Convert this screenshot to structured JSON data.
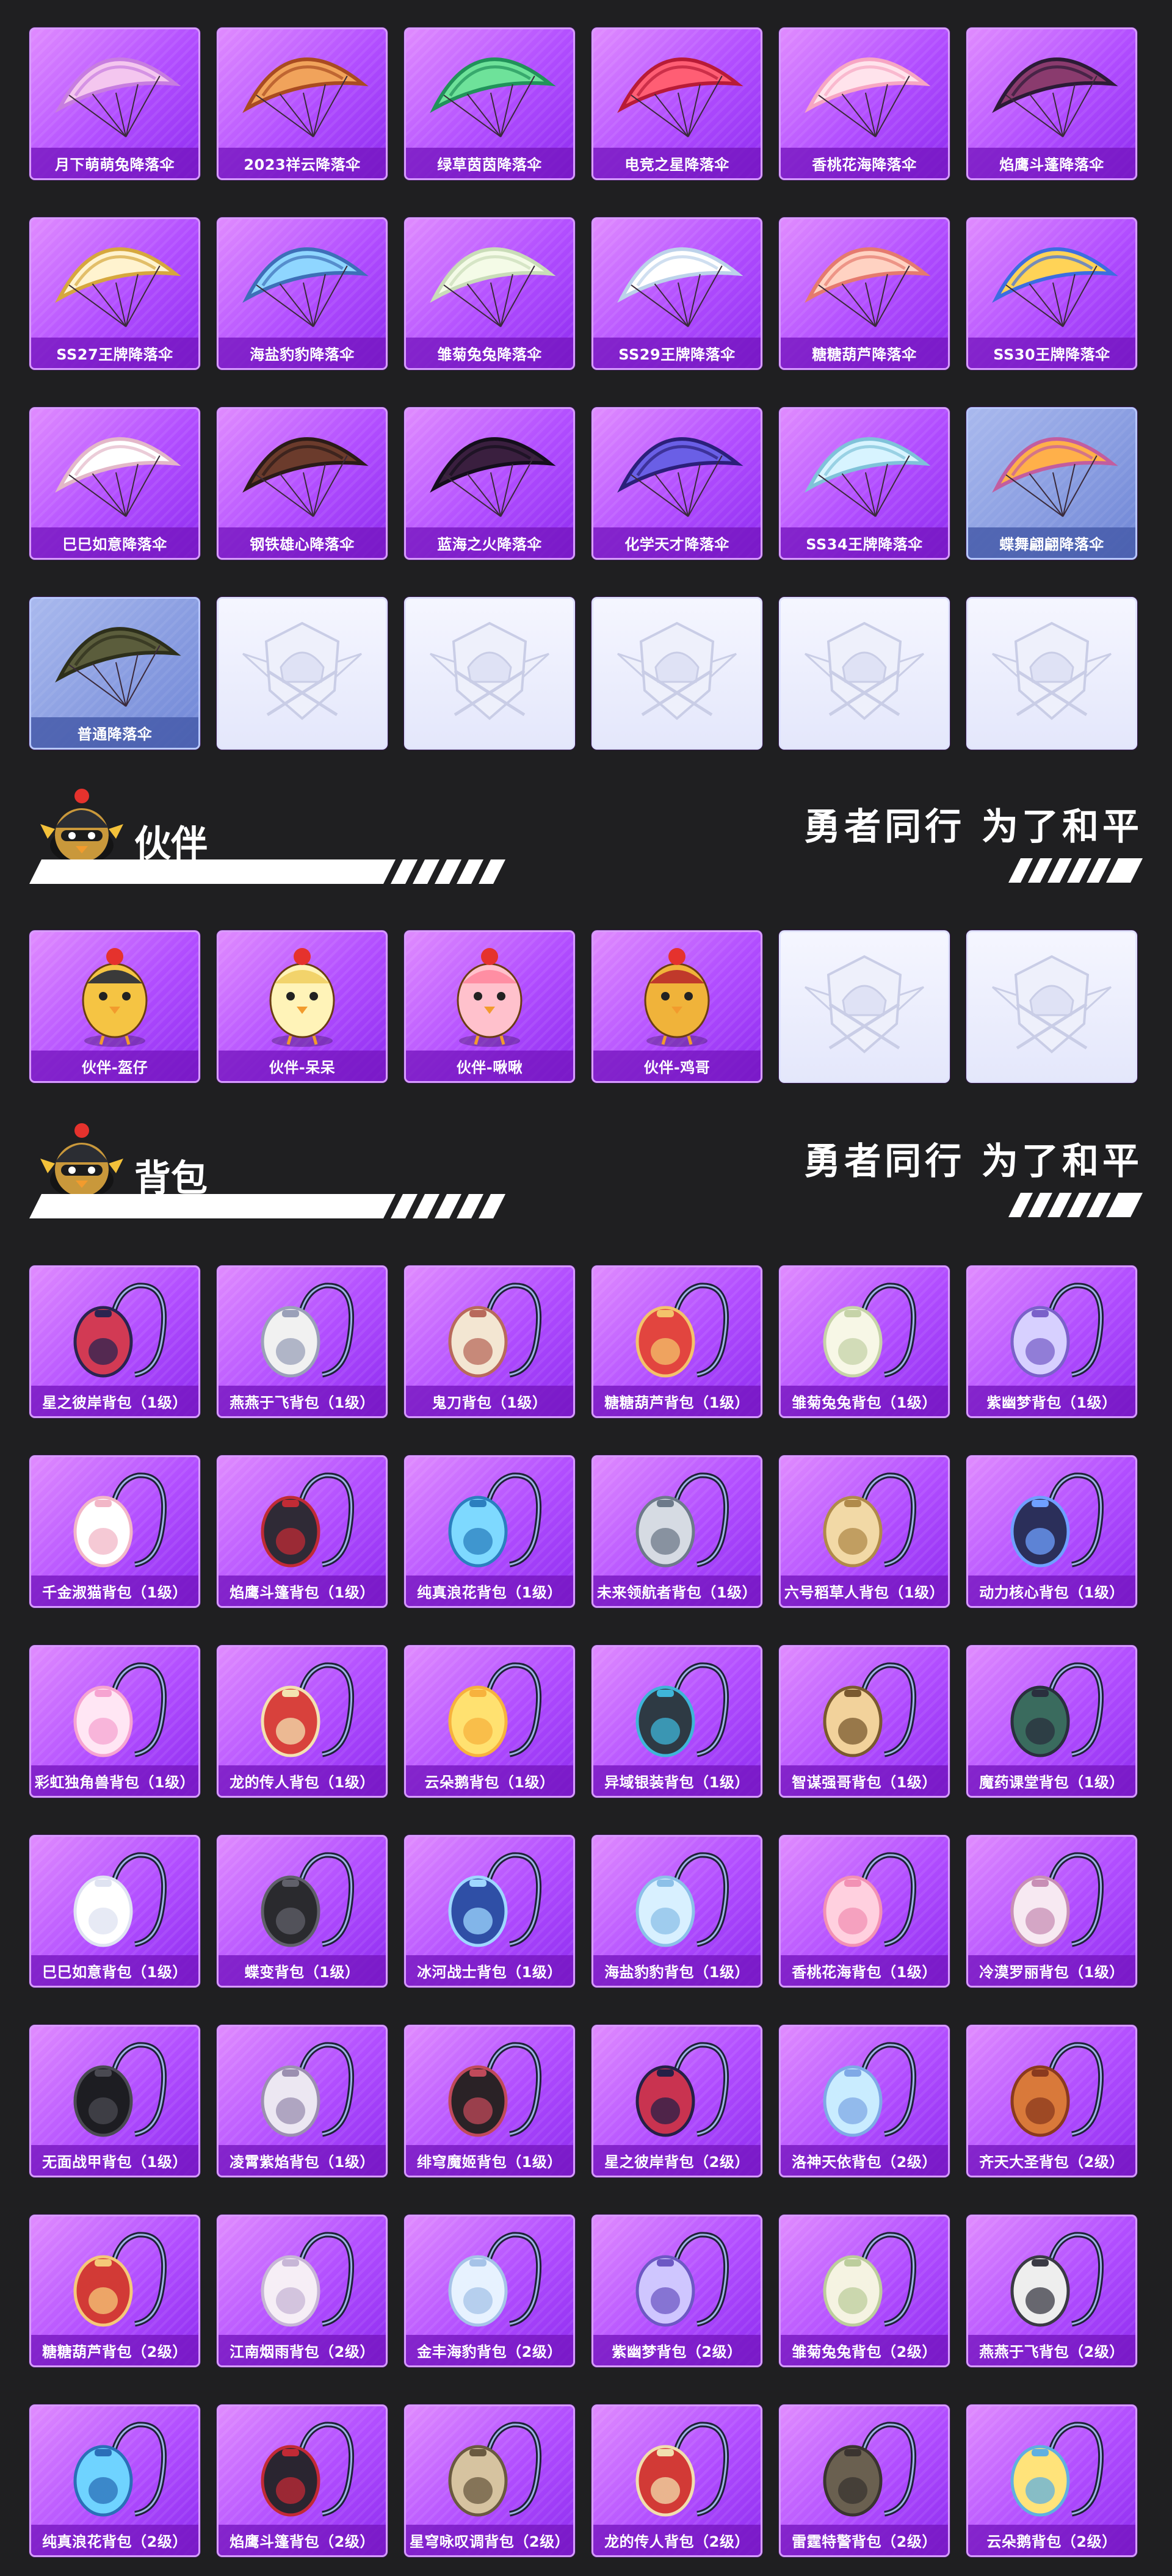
{
  "parachutes": [
    {
      "label": "月下萌萌兔降落伞",
      "c1": "#f4c6ef",
      "c2": "#c77de0",
      "style": "pink"
    },
    {
      "label": "2023祥云降落伞",
      "c1": "#f1a35b",
      "c2": "#a94b21",
      "style": "purple"
    },
    {
      "label": "绿草茵茵降落伞",
      "c1": "#6ee29a",
      "c2": "#21925a",
      "style": "pink"
    },
    {
      "label": "电竞之星降落伞",
      "c1": "#ff5e74",
      "c2": "#b81b37",
      "style": "pink"
    },
    {
      "label": "香桃花海降落伞",
      "c1": "#ffe3ec",
      "c2": "#f7a6c3",
      "style": "pink"
    },
    {
      "label": "焰鹰斗蓬降落伞",
      "c1": "#8a3b6e",
      "c2": "#2c1b36",
      "style": "pink"
    },
    {
      "label": "SS27王牌降落伞",
      "c1": "#fff3cf",
      "c2": "#d6a73d",
      "style": "pink"
    },
    {
      "label": "海盐豹豹降落伞",
      "c1": "#8fd6ff",
      "c2": "#3d6fb8",
      "style": "pink"
    },
    {
      "label": "雏菊兔兔降落伞",
      "c1": "#f4fbe7",
      "c2": "#c9dcb8",
      "style": "pink"
    },
    {
      "label": "SS29王牌降落伞",
      "c1": "#ffffff",
      "c2": "#bcd2ea",
      "style": "pink"
    },
    {
      "label": "糖糖葫芦降落伞",
      "c1": "#ffd2c2",
      "c2": "#e57a6e",
      "style": "pink"
    },
    {
      "label": "SS30王牌降落伞",
      "c1": "#ffd357",
      "c2": "#3c6de0",
      "style": "pink"
    },
    {
      "label": "巳巳如意降落伞",
      "c1": "#ffffff",
      "c2": "#e3b7c8",
      "style": "pink"
    },
    {
      "label": "钢铁雄心降落伞",
      "c1": "#6b3b2c",
      "c2": "#2b1b18",
      "style": "pink"
    },
    {
      "label": "蓝海之火降落伞",
      "c1": "#3a1f3f",
      "c2": "#140e1c",
      "style": "pink"
    },
    {
      "label": "化学天才降落伞",
      "c1": "#6a5fe6",
      "c2": "#2b1f7a",
      "style": "pink"
    },
    {
      "label": "SS34王牌降落伞",
      "c1": "#d7f4ff",
      "c2": "#7fc2d9",
      "style": "pink"
    },
    {
      "label": "蝶舞翩翩降落伞",
      "c1": "#ffb04a",
      "c2": "#c25d9f",
      "style": "blue"
    },
    {
      "label": "普通降落伞",
      "c1": "#5b5d3c",
      "c2": "#2d2f1b",
      "style": "blue"
    },
    {
      "label": "",
      "c1": "",
      "c2": "",
      "style": "blank"
    },
    {
      "label": "",
      "c1": "",
      "c2": "",
      "style": "blank"
    },
    {
      "label": "",
      "c1": "",
      "c2": "",
      "style": "blank"
    },
    {
      "label": "",
      "c1": "",
      "c2": "",
      "style": "blank"
    },
    {
      "label": "",
      "c1": "",
      "c2": "",
      "style": "blank"
    }
  ],
  "sections": {
    "companions": {
      "title": "伙伴",
      "slogan": "勇者同行 为了和平"
    },
    "backpacks": {
      "title": "背包",
      "slogan": "勇者同行 为了和平"
    }
  },
  "companions": [
    {
      "label": "伙伴-盔仔",
      "c1": "#f5c443",
      "c2": "#3a3a3a",
      "style": "pink"
    },
    {
      "label": "伙伴-呆呆",
      "c1": "#fff3b8",
      "c2": "#f2d36b",
      "style": "pink"
    },
    {
      "label": "伙伴-啾啾",
      "c1": "#ffc1cc",
      "c2": "#ff8ea3",
      "style": "pink"
    },
    {
      "label": "伙伴-鸡哥",
      "c1": "#f0b33a",
      "c2": "#c0392b",
      "style": "pink"
    },
    {
      "label": "",
      "c1": "",
      "c2": "",
      "style": "blank"
    },
    {
      "label": "",
      "c1": "",
      "c2": "",
      "style": "blank"
    }
  ],
  "backpacks": [
    {
      "label": "星之彼岸背包（1级）",
      "c1": "#d23a54",
      "c2": "#2a2450",
      "style": "pink"
    },
    {
      "label": "燕燕于飞背包（1级）",
      "c1": "#f1f1f1",
      "c2": "#9aa0b8",
      "style": "pink"
    },
    {
      "label": "鬼刀背包（1级）",
      "c1": "#f3e6d2",
      "c2": "#b86a5b",
      "style": "pink"
    },
    {
      "label": "糖糖葫芦背包（1级）",
      "c1": "#e2453f",
      "c2": "#f3c36b",
      "style": "pink"
    },
    {
      "label": "雏菊兔兔背包（1级）",
      "c1": "#f7f7e6",
      "c2": "#c6d3a8",
      "style": "pink"
    },
    {
      "label": "紫幽梦背包（1级）",
      "c1": "#d7d0ff",
      "c2": "#7a61c9",
      "style": "pink"
    },
    {
      "label": "千金淑猫背包（1级）",
      "c1": "#ffffff",
      "c2": "#f2b7c7",
      "style": "pink"
    },
    {
      "label": "焰鹰斗篷背包（1级）",
      "c1": "#2f2a36",
      "c2": "#c02b35",
      "style": "pink"
    },
    {
      "label": "纯真浪花背包（1级）",
      "c1": "#7ed9ff",
      "c2": "#2b7fbf",
      "style": "pink"
    },
    {
      "label": "未来领航者背包（1级）",
      "c1": "#d6dbe3",
      "c2": "#6d7a8a",
      "style": "pink"
    },
    {
      "label": "六号稻草人背包（1级）",
      "c1": "#f2d9a6",
      "c2": "#b08a4a",
      "style": "pink"
    },
    {
      "label": "动力核心背包（1级）",
      "c1": "#2b2f5a",
      "c2": "#6fa0ff",
      "style": "pink"
    },
    {
      "label": "彩虹独角兽背包（1级）",
      "c1": "#ffe6f4",
      "c2": "#f6a4d1",
      "style": "pink"
    },
    {
      "label": "龙的传人背包（1级）",
      "c1": "#d8413c",
      "c2": "#f3e2b0",
      "style": "pink"
    },
    {
      "label": "云朵鹅背包（1级）",
      "c1": "#ffe170",
      "c2": "#f7b23d",
      "style": "pink"
    },
    {
      "label": "异域银装背包（1级）",
      "c1": "#2e3a44",
      "c2": "#3fb5d8",
      "style": "pink"
    },
    {
      "label": "智谋强哥背包（1级）",
      "c1": "#f2d29b",
      "c2": "#7a5a2f",
      "style": "pink"
    },
    {
      "label": "魔药课堂背包（1级）",
      "c1": "#3a6b5e",
      "c2": "#2a2f3e",
      "style": "pink"
    },
    {
      "label": "巳巳如意背包（1级）",
      "c1": "#ffffff",
      "c2": "#dfe3f1",
      "style": "pink"
    },
    {
      "label": "蝶变背包（1级）",
      "c1": "#2a2a2e",
      "c2": "#60606a",
      "style": "pink"
    },
    {
      "label": "冰河战士背包（1级）",
      "c1": "#2f4fa6",
      "c2": "#9fd7ff",
      "style": "pink"
    },
    {
      "label": "海盐豹豹背包（1级）",
      "c1": "#d8f0ff",
      "c2": "#8cc0e8",
      "style": "pink"
    },
    {
      "label": "香桃花海背包（1级）",
      "c1": "#ffd0df",
      "c2": "#f291b4",
      "style": "pink"
    },
    {
      "label": "冷漠罗丽背包（1级）",
      "c1": "#f7e9f2",
      "c2": "#c88fb5",
      "style": "pink"
    },
    {
      "label": "无面战甲背包（1级）",
      "c1": "#1d1d22",
      "c2": "#4a4a52",
      "style": "pink"
    },
    {
      "label": "凌霄紫焰背包（1级）",
      "c1": "#ece7f2",
      "c2": "#9b8fb0",
      "style": "pink"
    },
    {
      "label": "绯穹魔姬背包（1级）",
      "c1": "#2a2226",
      "c2": "#c04a5a",
      "style": "pink"
    },
    {
      "label": "星之彼岸背包（2级）",
      "c1": "#c93350",
      "c2": "#252047",
      "style": "pink"
    },
    {
      "label": "洛神天依背包（2级）",
      "c1": "#c9ecff",
      "c2": "#7fa9e6",
      "style": "pink"
    },
    {
      "label": "齐天大圣背包（2级）",
      "c1": "#d9793a",
      "c2": "#8a3a1e",
      "style": "pink"
    },
    {
      "label": "糖糖葫芦背包（2级）",
      "c1": "#d23a36",
      "c2": "#f5c978",
      "style": "pink"
    },
    {
      "label": "江南烟雨背包（2级）",
      "c1": "#f6eef6",
      "c2": "#c7b6d6",
      "style": "pink"
    },
    {
      "label": "金丰海豹背包（2级）",
      "c1": "#e7f2ff",
      "c2": "#a6c3e8",
      "style": "pink"
    },
    {
      "label": "紫幽梦背包（2级）",
      "c1": "#cfc6ff",
      "c2": "#6d58c4",
      "style": "pink"
    },
    {
      "label": "雏菊兔兔背包（2级）",
      "c1": "#f5f3e2",
      "c2": "#bccd9c",
      "style": "pink"
    },
    {
      "label": "燕燕于飞背包（2级）",
      "c1": "#eeeeee",
      "c2": "#3a3a44",
      "style": "pink"
    },
    {
      "label": "纯真浪花背包（2级）",
      "c1": "#6fd3ff",
      "c2": "#2a6fb8",
      "style": "pink"
    },
    {
      "label": "焰鹰斗篷背包（2级）",
      "c1": "#2a2530",
      "c2": "#c22a35",
      "style": "pink"
    },
    {
      "label": "星穹咏叹调背包（2级）",
      "c1": "#d6c3a0",
      "c2": "#6a5a40",
      "style": "pink"
    },
    {
      "label": "龙的传人背包（2级）",
      "c1": "#d23a36",
      "c2": "#f1dfae",
      "style": "pink"
    },
    {
      "label": "雷霆特警背包（2级）",
      "c1": "#6a6050",
      "c2": "#3a3430",
      "style": "pink"
    },
    {
      "label": "云朵鹅背包（2级）",
      "c1": "#ffe37a",
      "c2": "#5fb0e0",
      "style": "pink"
    }
  ]
}
